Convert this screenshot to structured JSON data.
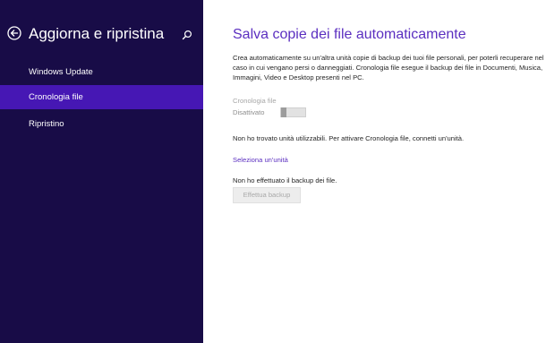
{
  "sidebar": {
    "title": "Aggiorna e ripristina",
    "back_icon": "back-arrow-circle-icon",
    "search_icon": "search-icon",
    "items": [
      {
        "label": "Windows Update",
        "active": false
      },
      {
        "label": "Cronologia file",
        "active": true
      },
      {
        "label": "Ripristino",
        "active": false
      }
    ]
  },
  "main": {
    "title": "Salva copie dei file automaticamente",
    "description": "Crea automaticamente su un'altra unità copie di backup dei tuoi file personali, per poterli recuperare nel caso in cui vengano persi o danneggiati. Cronologia file esegue il backup dei file in Documenti, Musica, Immagini, Video e Desktop presenti nel PC.",
    "toggle": {
      "label": "Cronologia file",
      "state": "Disattivato",
      "on": false
    },
    "no_drive_text": "Non ho trovato unità utilizzabili. Per attivare Cronologia file, connetti un'unità.",
    "select_drive_link": "Seleziona un'unità",
    "no_backup_text": "Non ho effettuato il backup dei file.",
    "backup_button": "Effettua backup"
  },
  "colors": {
    "sidebar_bg": "#180c47",
    "selected_item_bg": "#4617b4",
    "accent": "#5b2fc0"
  }
}
